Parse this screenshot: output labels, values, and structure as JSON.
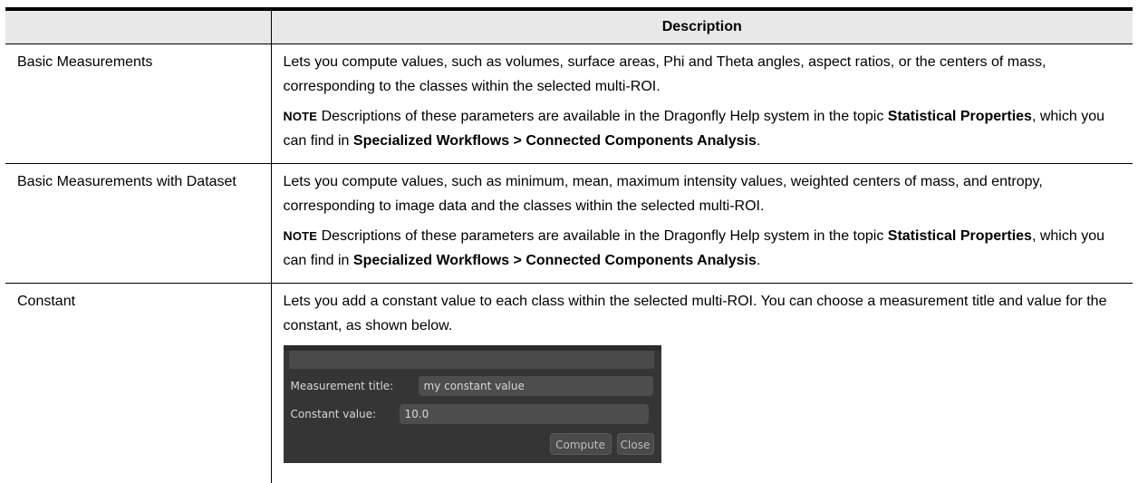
{
  "header": {
    "col1": "",
    "col2": "Description"
  },
  "rows": [
    {
      "name": "Basic Measurements",
      "desc": "Lets you compute values, such as volumes, surface areas, Phi and Theta angles, aspect ratios, or the centers of mass, corresponding to the classes within the selected multi-ROI.",
      "note": {
        "label_first": "N",
        "label_rest": "OTE",
        "pre": " Descriptions of these parameters are available in the Dragonfly Help system in the topic ",
        "bold1": "Statistical Properties",
        "mid": ", which you can find in ",
        "bold2": "Specialized Workflows > Connected Components Analysis",
        "post": "."
      }
    },
    {
      "name": "Basic Measurements with Dataset",
      "desc": "Lets you compute values, such as minimum, mean, maximum intensity values, weighted centers of mass, and entropy, corresponding to image data and the classes within the selected multi-ROI.",
      "note": {
        "label_first": "N",
        "label_rest": "OTE",
        "pre": " Descriptions of these parameters are available in the Dragonfly Help system in the topic ",
        "bold1": "Statistical Properties",
        "mid": ", which you can find in ",
        "bold2": "Specialized Workflows > Connected Components Analysis",
        "post": "."
      }
    },
    {
      "name": "Constant",
      "desc": "Lets you add a constant value to each class within the selected multi-ROI. You can choose a measurement title and value for the constant, as shown below."
    }
  ],
  "dialog": {
    "title_label": "Measurement title:",
    "title_value": "my constant value",
    "value_label": "Constant value:",
    "value_value": "10.0",
    "compute": "Compute",
    "close": "Close"
  }
}
